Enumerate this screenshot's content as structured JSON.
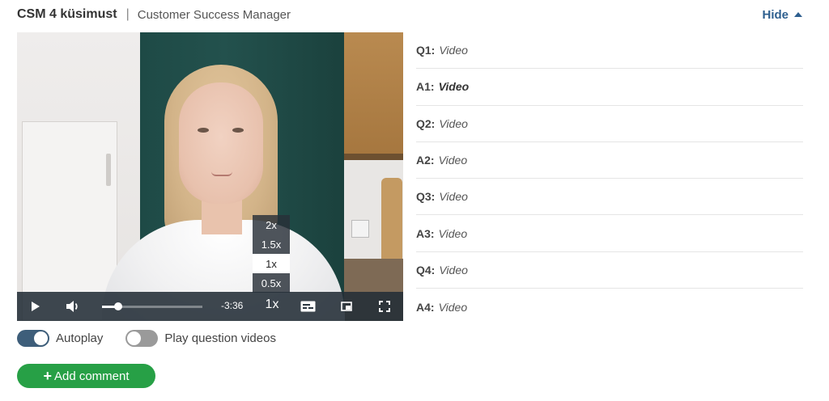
{
  "header": {
    "title": "CSM 4 küsimust",
    "separator": "|",
    "subtitle": "Customer Success Manager",
    "hide_label": "Hide",
    "hide_icon": "caret-up-icon"
  },
  "player": {
    "time_remaining": "-3:36",
    "speed_label": "1x",
    "progress_fraction": 0.16,
    "speed_options": [
      "2x",
      "1.5x",
      "1x",
      "0.5x"
    ],
    "selected_speed": "1x",
    "icons": [
      "play-icon",
      "volume-icon",
      "captions-icon",
      "picture-in-picture-icon",
      "fullscreen-icon"
    ]
  },
  "qa_list": [
    {
      "key": "Q1:",
      "value": "Video"
    },
    {
      "key": "A1:",
      "value": "Video",
      "current": true
    },
    {
      "key": "Q2:",
      "value": "Video"
    },
    {
      "key": "A2:",
      "value": "Video"
    },
    {
      "key": "Q3:",
      "value": "Video"
    },
    {
      "key": "A3:",
      "value": "Video"
    },
    {
      "key": "Q4:",
      "value": "Video"
    },
    {
      "key": "A4:",
      "value": "Video"
    }
  ],
  "toggles": {
    "autoplay": {
      "label": "Autoplay",
      "on": true
    },
    "question_videos": {
      "label": "Play question videos",
      "on": false
    }
  },
  "add_comment": {
    "plus": "+",
    "label": "Add comment"
  },
  "colors": {
    "accent_blue": "#2e5f8f",
    "green_button": "#27a046",
    "toggle_on": "#3e5e7a"
  }
}
